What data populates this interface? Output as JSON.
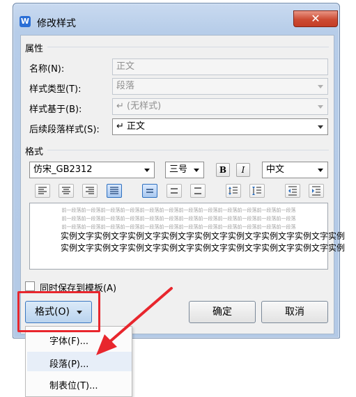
{
  "window": {
    "title": "修改样式",
    "app_icon_letter": "W",
    "close_glyph": "✕"
  },
  "properties": {
    "section_title": "属性",
    "name_label": "名称(N):",
    "name_value": "正文",
    "type_label": "样式类型(T):",
    "type_value": "段落",
    "based_on_label": "样式基于(B):",
    "based_on_value": "↵ (无样式)",
    "next_label": "后续段落样式(S):",
    "next_value": "↵ 正文"
  },
  "format": {
    "section_title": "格式",
    "font_name": "仿宋_GB2312",
    "font_size": "三号",
    "bold_label": "B",
    "italic_label": "I",
    "language": "中文",
    "alignment_active": "justify"
  },
  "preview": {
    "prev_paragraph_line": "前一段落前一段落前一段落前一段落前一段落前一段落前一段落前一段落前一段落前一段落前一段落前一段落",
    "sample_line": "实例文字实例文字实例文字实例文字实例文字实例文字实例文字实例文字实例"
  },
  "save_to_template_label": "同时保存到模板(A)",
  "buttons": {
    "format": "格式(O)",
    "ok": "确定",
    "cancel": "取消"
  },
  "menu": {
    "items": [
      "字体(F)...",
      "段落(P)...",
      "制表位(T)..."
    ],
    "hovered_index": 1
  },
  "colors": {
    "highlight": "#e8262d",
    "accent": "#2b6fd6"
  }
}
